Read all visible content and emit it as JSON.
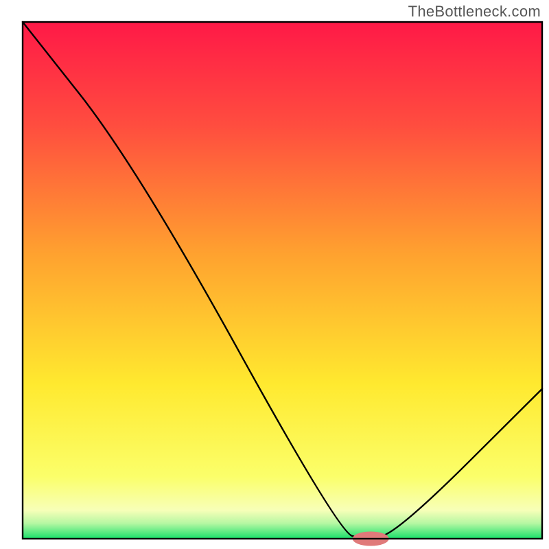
{
  "attribution": "TheBottleneck.com",
  "chart_data": {
    "type": "line",
    "title": "",
    "xlabel": "",
    "ylabel": "",
    "xlim": [
      0,
      100
    ],
    "ylim": [
      0,
      100
    ],
    "x": [
      0,
      22,
      61,
      66,
      72,
      100
    ],
    "values": [
      100,
      72,
      1,
      0,
      1,
      29
    ],
    "optimum_marker": {
      "x": 67,
      "y": 0,
      "rx": 3.5,
      "ry": 1.4,
      "color": "#e07a7a"
    },
    "gradient_stops": [
      {
        "pct": 0,
        "color": "#ff1947"
      },
      {
        "pct": 20,
        "color": "#ff4d3f"
      },
      {
        "pct": 45,
        "color": "#ffa22f"
      },
      {
        "pct": 70,
        "color": "#ffe92f"
      },
      {
        "pct": 88,
        "color": "#fbff6a"
      },
      {
        "pct": 94.5,
        "color": "#f7ffb8"
      },
      {
        "pct": 97,
        "color": "#b7f7a3"
      },
      {
        "pct": 100,
        "color": "#18e06a"
      }
    ],
    "frame": {
      "stroke": "#000000",
      "stroke_width": 2.4
    }
  }
}
